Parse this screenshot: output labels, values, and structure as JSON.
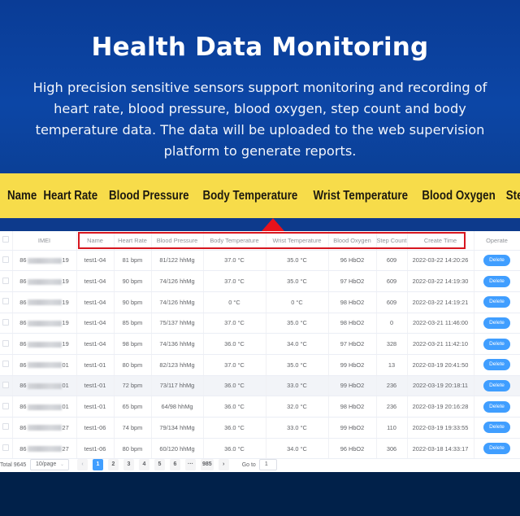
{
  "hero": {
    "title": "Health Data Monitoring",
    "description": "High precision sensitive sensors support monitoring and recording of heart rate, blood pressure, blood oxygen, step count and body temperature data. The data will be uploaded to the web supervision platform to generate reports."
  },
  "features": [
    "Name",
    "Heart Rate",
    "Blood Pressure",
    "Body Temperature",
    "Wrist Temperature",
    "Blood Oxygen",
    "Step Count"
  ],
  "colors": {
    "band": "#f7dc4a",
    "highlight": "#d7161f",
    "primary": "#409eff",
    "background": "#0a3d99"
  },
  "table": {
    "columns": [
      "IMEI",
      "Name",
      "Heart Rate",
      "Blood Pressure",
      "Body Temperature",
      "Wrist Temperature",
      "Blood Oxygen",
      "Step Count",
      "Create Time",
      "Operate"
    ],
    "delete_label": "Delete",
    "rows": [
      {
        "imei_prefix": "86",
        "imei_suffix": "19",
        "name": "test1-04",
        "heart_rate": "81 bpm",
        "blood_pressure": "81/122 hhMg",
        "body_temp": "37.0 °C",
        "wrist_temp": "35.0 °C",
        "blood_oxygen": "96 HbO2",
        "step_count": "609",
        "create_time": "2022-03-22 14:20:26"
      },
      {
        "imei_prefix": "86",
        "imei_suffix": "19",
        "name": "test1-04",
        "heart_rate": "90 bpm",
        "blood_pressure": "74/126 hhMg",
        "body_temp": "37.0 °C",
        "wrist_temp": "35.0 °C",
        "blood_oxygen": "97 HbO2",
        "step_count": "609",
        "create_time": "2022-03-22 14:19:30"
      },
      {
        "imei_prefix": "86",
        "imei_suffix": "19",
        "name": "test1-04",
        "heart_rate": "90 bpm",
        "blood_pressure": "74/126 hhMg",
        "body_temp": "0 °C",
        "wrist_temp": "0 °C",
        "blood_oxygen": "98 HbO2",
        "step_count": "609",
        "create_time": "2022-03-22 14:19:21"
      },
      {
        "imei_prefix": "86",
        "imei_suffix": "19",
        "name": "test1-04",
        "heart_rate": "85 bpm",
        "blood_pressure": "75/137 hhMg",
        "body_temp": "37.0 °C",
        "wrist_temp": "35.0 °C",
        "blood_oxygen": "98 HbO2",
        "step_count": "0",
        "create_time": "2022-03-21 11:46:00"
      },
      {
        "imei_prefix": "86",
        "imei_suffix": "19",
        "name": "test1-04",
        "heart_rate": "98 bpm",
        "blood_pressure": "74/136 hhMg",
        "body_temp": "36.0 °C",
        "wrist_temp": "34.0 °C",
        "blood_oxygen": "97 HbO2",
        "step_count": "328",
        "create_time": "2022-03-21 11:42:10"
      },
      {
        "imei_prefix": "86",
        "imei_suffix": "01",
        "name": "test1-01",
        "heart_rate": "80 bpm",
        "blood_pressure": "82/123 hhMg",
        "body_temp": "37.0 °C",
        "wrist_temp": "35.0 °C",
        "blood_oxygen": "99 HbO2",
        "step_count": "13",
        "create_time": "2022-03-19 20:41:50"
      },
      {
        "imei_prefix": "86",
        "imei_suffix": "01",
        "name": "test1-01",
        "heart_rate": "72 bpm",
        "blood_pressure": "73/117 hhMg",
        "body_temp": "36.0 °C",
        "wrist_temp": "33.0 °C",
        "blood_oxygen": "99 HbO2",
        "step_count": "236",
        "create_time": "2022-03-19 20:18:11"
      },
      {
        "imei_prefix": "86",
        "imei_suffix": "01",
        "name": "test1-01",
        "heart_rate": "65 bpm",
        "blood_pressure": "64/98 hhMg",
        "body_temp": "36.0 °C",
        "wrist_temp": "32.0 °C",
        "blood_oxygen": "98 HbO2",
        "step_count": "236",
        "create_time": "2022-03-19 20:16:28"
      },
      {
        "imei_prefix": "86",
        "imei_suffix": "27",
        "name": "test1-06",
        "heart_rate": "74 bpm",
        "blood_pressure": "79/134 hhMg",
        "body_temp": "36.0 °C",
        "wrist_temp": "33.0 °C",
        "blood_oxygen": "99 HbO2",
        "step_count": "110",
        "create_time": "2022-03-19 19:33:55"
      },
      {
        "imei_prefix": "86",
        "imei_suffix": "27",
        "name": "test1-06",
        "heart_rate": "80 bpm",
        "blood_pressure": "60/120 hhMg",
        "body_temp": "36.0 °C",
        "wrist_temp": "34.0 °C",
        "blood_oxygen": "96 HbO2",
        "step_count": "306",
        "create_time": "2022-03-18 14:33:17"
      }
    ],
    "hover_row_index": 6
  },
  "pagination": {
    "total_label": "Total 9645",
    "page_size": "10/page",
    "prev_icon": "‹",
    "next_icon": "›",
    "pages": [
      "1",
      "2",
      "3",
      "4",
      "5",
      "6",
      "···",
      "985"
    ],
    "current_page": "1",
    "goto_label": "Go to",
    "goto_value": "1"
  }
}
